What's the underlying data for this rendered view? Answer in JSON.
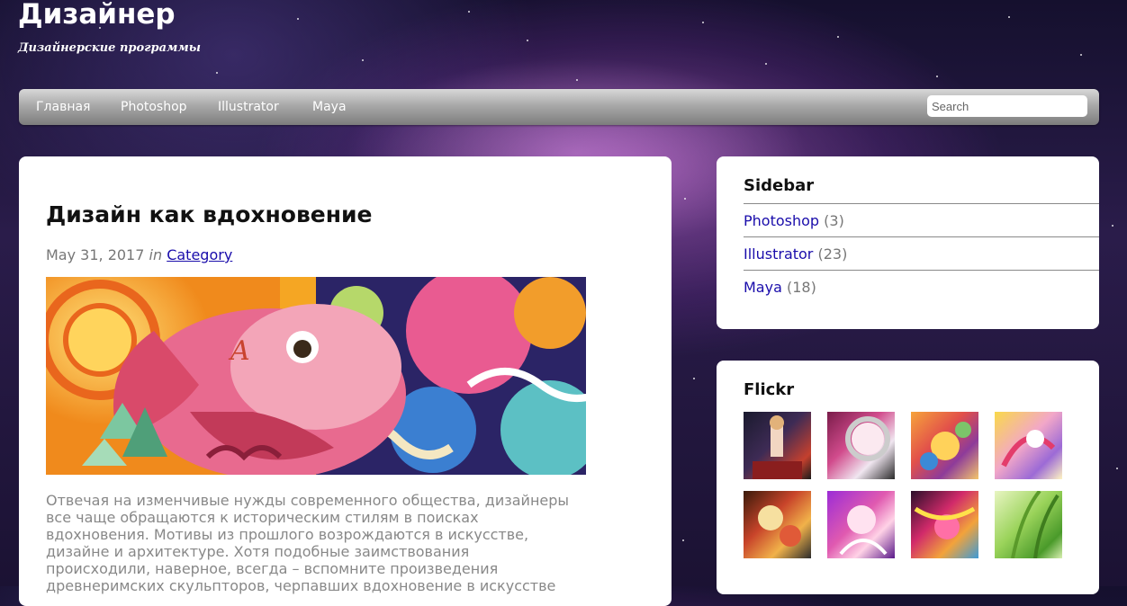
{
  "site": {
    "title": "Дизайнер",
    "description": "Дизайнерские программы"
  },
  "nav": {
    "items": [
      {
        "label": "Главная"
      },
      {
        "label": "Photoshop"
      },
      {
        "label": "Illustrator"
      },
      {
        "label": "Maya"
      }
    ],
    "search_placeholder": "Search"
  },
  "post": {
    "title": "Дизайн как вдохновение",
    "date": "May 31, 2017",
    "in_word": "in",
    "category": "Category",
    "image_icon": "koi-fish-illustration",
    "body": "Отвечая на изменчивые нужды современного общества, дизайнеры все чаще обращаются к историческим стилям в поисках вдохновения. Мотивы из прошлого возрождаются в искусстве, дизайне и архитектуре. Хотя подобные заимствования происходили, наверное, всегда – вспомните произведения древнеримских скульпторов, черпавших вдохновение в искусстве"
  },
  "sidebar": {
    "title": "Sidebar",
    "categories": [
      {
        "label": "Photoshop",
        "count": "(3)"
      },
      {
        "label": "Illustrator",
        "count": "(23)"
      },
      {
        "label": "Maya",
        "count": "(18)"
      }
    ]
  },
  "flickr": {
    "title": "Flickr",
    "thumbnails": [
      {
        "icon": "photo-thumbnail"
      },
      {
        "icon": "photo-thumbnail"
      },
      {
        "icon": "photo-thumbnail"
      },
      {
        "icon": "photo-thumbnail"
      },
      {
        "icon": "photo-thumbnail"
      },
      {
        "icon": "photo-thumbnail"
      },
      {
        "icon": "photo-thumbnail"
      },
      {
        "icon": "photo-thumbnail"
      }
    ]
  },
  "colors": {
    "link": "#1a0dab",
    "muted_text": "#777777",
    "card_bg": "#ffffff"
  }
}
